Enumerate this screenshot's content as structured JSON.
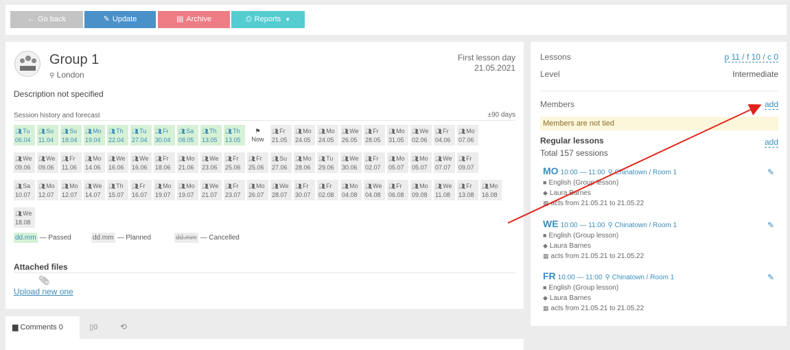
{
  "toolbar": {
    "back_label": "Go back",
    "update_label": "Update",
    "archive_label": "Archive",
    "reports_label": "Reports"
  },
  "group": {
    "name": "Group 1",
    "location": "London",
    "first_lesson_label": "First lesson day",
    "first_lesson_date": "21.05.2021",
    "description": "Description not specified"
  },
  "sessions": {
    "title": "Session history and forecast",
    "range": "±90 days",
    "now_label": "Now",
    "rows": [
      [
        {
          "day": "Tu",
          "date": "06.04",
          "status": "passed"
        },
        {
          "day": "Su",
          "date": "11.04",
          "status": "passed"
        },
        {
          "day": "Su",
          "date": "18.04",
          "status": "passed"
        },
        {
          "day": "Mo",
          "date": "19.04",
          "status": "passed"
        },
        {
          "day": "Th",
          "date": "22.04",
          "status": "passed"
        },
        {
          "day": "Tu",
          "date": "27.04",
          "status": "passed"
        },
        {
          "day": "Fr",
          "date": "30.04",
          "status": "passed"
        },
        {
          "day": "Sa",
          "date": "08.05",
          "status": "passed"
        },
        {
          "day": "Th",
          "date": "13.05",
          "status": "passed"
        },
        {
          "day": "Th",
          "date": "13.05",
          "status": "passed"
        },
        {
          "day": "",
          "date": "Now",
          "status": "now"
        },
        {
          "day": "Fr",
          "date": "21.05",
          "status": "planned"
        },
        {
          "day": "Mo",
          "date": "24.05",
          "status": "planned"
        },
        {
          "day": "Mo",
          "date": "24.05",
          "status": "planned"
        },
        {
          "day": "We",
          "date": "26.05",
          "status": "planned"
        },
        {
          "day": "Fr",
          "date": "28.05",
          "status": "planned"
        },
        {
          "day": "Mo",
          "date": "31.05",
          "status": "planned"
        },
        {
          "day": "We",
          "date": "02.06",
          "status": "planned"
        },
        {
          "day": "Fr",
          "date": "04.06",
          "status": "planned"
        },
        {
          "day": "Mo",
          "date": "07.06",
          "status": "planned"
        }
      ],
      [
        {
          "day": "We",
          "date": "09.06",
          "status": "planned"
        },
        {
          "day": "We",
          "date": "09.06",
          "status": "planned"
        },
        {
          "day": "Fr",
          "date": "11.06",
          "status": "planned"
        },
        {
          "day": "Mo",
          "date": "14.06",
          "status": "planned"
        },
        {
          "day": "We",
          "date": "16.06",
          "status": "planned"
        },
        {
          "day": "We",
          "date": "16.06",
          "status": "planned"
        },
        {
          "day": "Fr",
          "date": "18.06",
          "status": "planned"
        },
        {
          "day": "Mo",
          "date": "21.06",
          "status": "planned"
        },
        {
          "day": "We",
          "date": "23.06",
          "status": "planned"
        },
        {
          "day": "Fr",
          "date": "25.06",
          "status": "planned"
        },
        {
          "day": "Fr",
          "date": "25.06",
          "status": "planned"
        },
        {
          "day": "Su",
          "date": "27.06",
          "status": "planned"
        },
        {
          "day": "Mo",
          "date": "28.06",
          "status": "planned"
        },
        {
          "day": "Tu",
          "date": "29.06",
          "status": "planned"
        },
        {
          "day": "We",
          "date": "30.06",
          "status": "planned"
        },
        {
          "day": "Fr",
          "date": "02.07",
          "status": "planned"
        },
        {
          "day": "Mo",
          "date": "05.07",
          "status": "planned"
        },
        {
          "day": "Mo",
          "date": "05.07",
          "status": "planned"
        },
        {
          "day": "We",
          "date": "07.07",
          "status": "planned"
        },
        {
          "day": "Fr",
          "date": "09.07",
          "status": "planned"
        }
      ],
      [
        {
          "day": "Sa",
          "date": "10.07",
          "status": "planned"
        },
        {
          "day": "Mo",
          "date": "12.07",
          "status": "planned"
        },
        {
          "day": "Mo",
          "date": "12.07",
          "status": "planned"
        },
        {
          "day": "We",
          "date": "14.07",
          "status": "planned"
        },
        {
          "day": "Th",
          "date": "15.07",
          "status": "planned"
        },
        {
          "day": "Fr",
          "date": "16.07",
          "status": "planned"
        },
        {
          "day": "Mo",
          "date": "19.07",
          "status": "planned"
        },
        {
          "day": "Mo",
          "date": "19.07",
          "status": "planned"
        },
        {
          "day": "We",
          "date": "21.07",
          "status": "planned"
        },
        {
          "day": "Fr",
          "date": "23.07",
          "status": "planned"
        },
        {
          "day": "Mo",
          "date": "26.07",
          "status": "planned"
        },
        {
          "day": "We",
          "date": "28.07",
          "status": "planned"
        },
        {
          "day": "Fr",
          "date": "30.07",
          "status": "planned"
        },
        {
          "day": "Fr",
          "date": "02.08",
          "status": "planned"
        },
        {
          "day": "Mo",
          "date": "04.08",
          "status": "planned"
        },
        {
          "day": "We",
          "date": "04.08",
          "status": "planned"
        },
        {
          "day": "Fr",
          "date": "06.08",
          "status": "planned"
        },
        {
          "day": "Mo",
          "date": "09.08",
          "status": "planned"
        },
        {
          "day": "We",
          "date": "11.08",
          "status": "planned"
        },
        {
          "day": "Fr",
          "date": "13.08",
          "status": "planned"
        },
        {
          "day": "Mo",
          "date": "16.08",
          "status": "planned"
        }
      ],
      [
        {
          "day": "We",
          "date": "18.08",
          "status": "planned"
        }
      ]
    ],
    "legend": {
      "swatch_text": "dd.mm",
      "passed": "— Passed",
      "planned": "— Planned",
      "cancelled": "— Cancelled"
    }
  },
  "files": {
    "title": "Attached files",
    "upload_label": "Upload new one"
  },
  "tabs": {
    "comments_label": "Comments 0",
    "files_count": "0"
  },
  "side": {
    "lessons_label": "Lessons",
    "lessons_value": "p 11 / f 10 / c 0",
    "level_label": "Level",
    "level_value": "Intermediate",
    "members_label": "Members",
    "members_add": "add",
    "members_notice": "Members are not tied",
    "regular_label": "Regular lessons",
    "regular_add": "add",
    "total_sessions": "Total 157 sessions",
    "lessons": [
      {
        "day": "MO",
        "time": "10:00 — 11:00",
        "room": "Chinatown / Room 1",
        "subject": "English (Group lesson)",
        "teacher": "Laura Barnes",
        "period": "acts from 21.05.21 to 21.05.22"
      },
      {
        "day": "WE",
        "time": "10:00 — 11:00",
        "room": "Chinatown / Room 1",
        "subject": "English (Group lesson)",
        "teacher": "Laura Barnes",
        "period": "acts from 21.05.21 to 21.05.22"
      },
      {
        "day": "FR",
        "time": "10:00 — 11:00",
        "room": "Chinatown / Room 1",
        "subject": "English (Group lesson)",
        "teacher": "Laura Barnes",
        "period": "acts from 21.05.21 to 21.05.22"
      }
    ]
  },
  "colors": {
    "accent": "#3b8db9",
    "arrow": "#e2231a",
    "passed_bg": "#d6f1d6",
    "notice_bg": "#fcf6da"
  }
}
